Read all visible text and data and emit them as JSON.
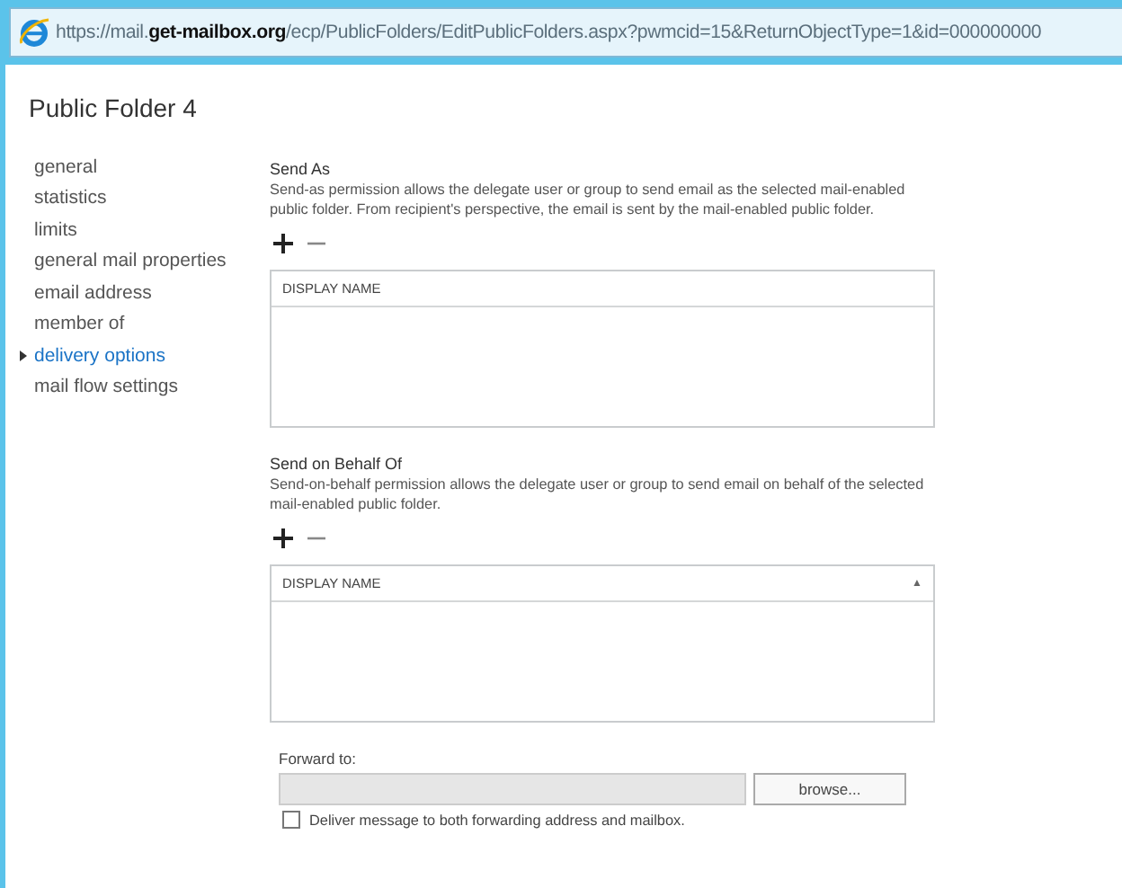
{
  "address_bar": {
    "url": "https://mail.**get-mailbox.org**/ecp/PublicFolders/EditPublicFolders.aspx?pwmcid=15&ReturnObjectType=1&id=000000000"
  },
  "title": "Public Folder 4",
  "nav": [
    {
      "label": "general",
      "selected": false
    },
    {
      "label": "statistics",
      "selected": false
    },
    {
      "label": "limits",
      "selected": false
    },
    {
      "label": "general mail properties",
      "selected": false
    },
    {
      "label": "email address",
      "selected": false
    },
    {
      "label": "member of",
      "selected": false
    },
    {
      "label": "delivery options",
      "selected": true
    },
    {
      "label": "mail flow settings",
      "selected": false
    }
  ],
  "sections": [
    {
      "heading": "Send As",
      "description": "Send-as permission allows the delegate user or group to send email as the selected mail-enabled public folder. From recipient's perspective, the email is sent by the mail-enabled public folder.",
      "column": "DISPLAY NAME"
    },
    {
      "heading": "Send on Behalf Of",
      "description": "Send-on-behalf permission allows the delegate user or group to send email on behalf of the selected mail-enabled public folder.",
      "column": "DISPLAY NAME",
      "sort_indicator": "▲"
    }
  ],
  "forward": {
    "label": "Forward to:",
    "button": "browse...",
    "checkbox": {
      "label": "Deliver message to both forwarding address and mailbox.",
      "checked": false
    }
  }
}
